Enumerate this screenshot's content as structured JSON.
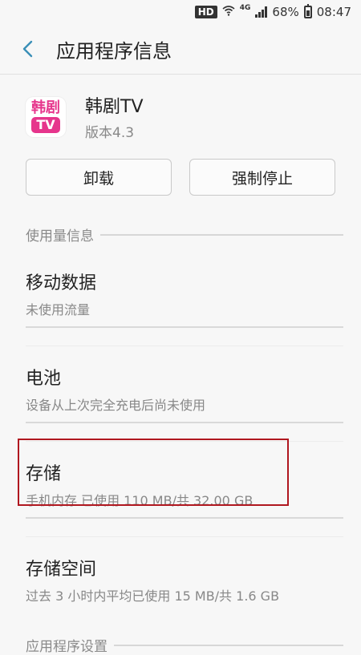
{
  "status_bar": {
    "hd_label": "HD",
    "network_label": "4G",
    "battery": "68%",
    "time": "08:47"
  },
  "header": {
    "title": "应用程序信息"
  },
  "app": {
    "icon_text_top": "韩剧",
    "icon_text_bottom": "TV",
    "name": "韩剧TV",
    "version": "版本4.3"
  },
  "buttons": {
    "uninstall": "卸载",
    "force_stop": "强制停止"
  },
  "sections": {
    "usage": "使用量信息",
    "app_settings": "应用程序设置"
  },
  "items": [
    {
      "title": "移动数据",
      "subtitle": "未使用流量"
    },
    {
      "title": "电池",
      "subtitle": "设备从上次完全充电后尚未使用"
    },
    {
      "title": "存储",
      "subtitle": "手机内存 已使用 110 MB/共 32.00 GB"
    },
    {
      "title": "存储空间",
      "subtitle": "过去 3 小时内平均已使用 15 MB/共 1.6 GB"
    }
  ],
  "icons": {
    "back": "back-arrow-icon",
    "wifi": "wifi-icon",
    "signal": "signal-icon",
    "battery": "battery-icon"
  },
  "colors": {
    "accent": "#3a8fb7",
    "highlight": "#b0171f",
    "brand": "#e6358c"
  }
}
